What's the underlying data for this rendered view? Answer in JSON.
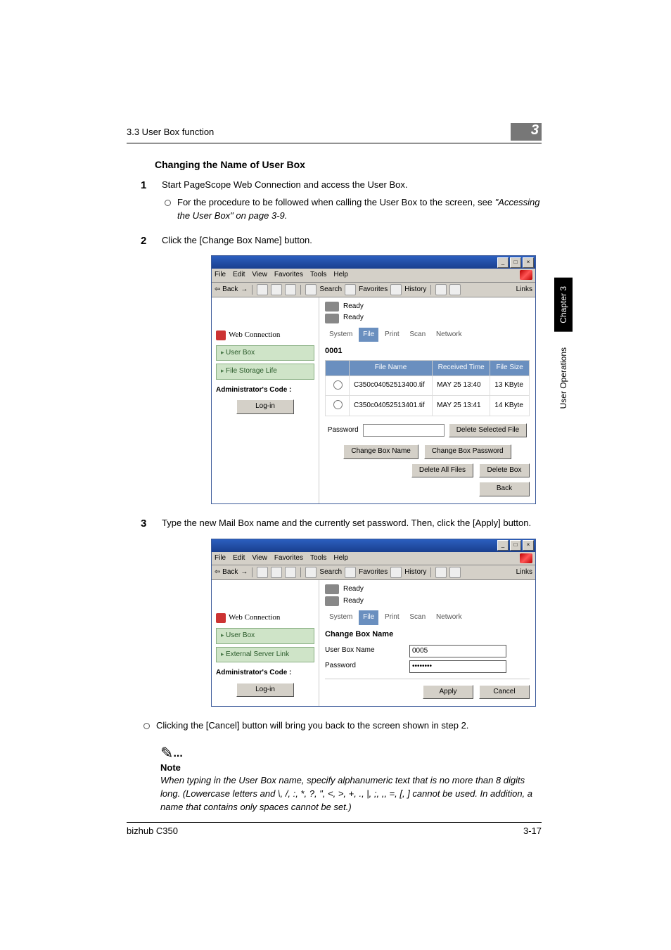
{
  "header": {
    "crumb": "3.3 User Box function",
    "section": "3"
  },
  "title": "Changing the Name of User Box",
  "steps": [
    {
      "text": "Start PageScope Web Connection and access the User Box.",
      "sub": [
        {
          "prefix": "For the procedure to be followed when calling the User Box to the screen, see ",
          "italic": "\"Accessing the User Box\" on page 3-9."
        }
      ]
    },
    {
      "text": "Click the [Change Box Name] button."
    },
    {
      "text": "Type the new Mail Box name and the currently set password. Then, click the [Apply] button."
    }
  ],
  "afterFig2Sub": {
    "text": "Clicking the [Cancel] button will bring you back to the screen shown in step 2."
  },
  "note": {
    "head": "Note",
    "body": "When typing in the User Box name, specify alphanumeric text that is no more than 8 digits long. (Lowercase letters and \\, /, :, *, ?, \", <, >, +, ., |, ;, ,, =, [, ] cannot be used. In addition, a name that contains only spaces cannot be set.)"
  },
  "browser": {
    "menus": [
      "File",
      "Edit",
      "View",
      "Favorites",
      "Tools",
      "Help"
    ],
    "toolbar": {
      "back": "Back",
      "search": "Search",
      "favorites": "Favorites",
      "history": "History"
    },
    "links": "Links"
  },
  "webapp": {
    "brand": "Web Connection",
    "ready": "Ready",
    "tabs": [
      "System",
      "File",
      "Print",
      "Scan",
      "Network"
    ],
    "side": {
      "userbox": "User Box",
      "storage": "File Storage Life",
      "external": "External Server Link",
      "admin": "Administrator's Code :",
      "login": "Log-in"
    }
  },
  "fig1": {
    "boxnum": "0001",
    "cols": [
      "File Name",
      "Received Time",
      "File Size"
    ],
    "rows": [
      {
        "name": "C350c04052513400.tif",
        "time": "MAY 25 13:40",
        "size": "13 KByte"
      },
      {
        "name": "C350c04052513401.tif",
        "time": "MAY 25 13:41",
        "size": "14 KByte"
      }
    ],
    "pw": "Password",
    "btns": {
      "delSel": "Delete Selected File",
      "chgName": "Change Box Name",
      "chgPw": "Change Box Password",
      "delAll": "Delete All Files",
      "delBox": "Delete Box",
      "back": "Back"
    }
  },
  "fig2": {
    "heading": "Change Box Name",
    "rows": {
      "name": "User Box Name",
      "nameval": "0005",
      "pw": "Password",
      "pwval": "••••••••"
    },
    "btns": {
      "apply": "Apply",
      "cancel": "Cancel"
    }
  },
  "footer": {
    "left": "bizhub C350",
    "right": "3-17"
  },
  "side": {
    "chapter": "Chapter 3",
    "ops": "User Operations"
  }
}
